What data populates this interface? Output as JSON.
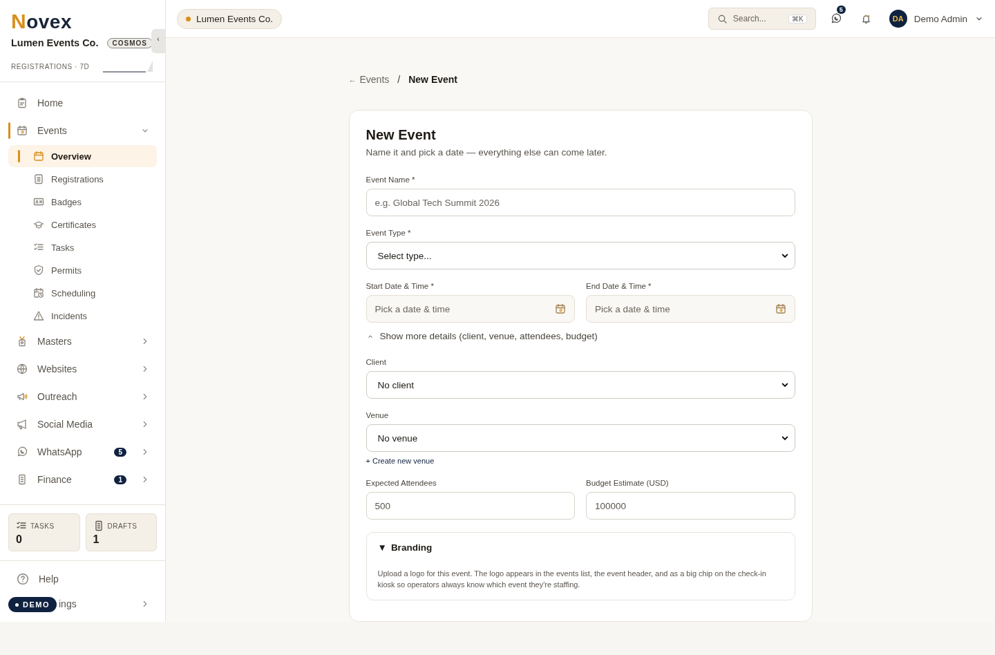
{
  "brand": {
    "logo_mark": "N",
    "logo_rest": "ovex"
  },
  "org": {
    "name": "Lumen Events Co.",
    "plan": "COSMOS"
  },
  "sparkline": {
    "label": "REGISTRATIONS · 7D"
  },
  "nav": [
    {
      "kind": "item",
      "label": "Home",
      "selected": false
    },
    {
      "kind": "group",
      "label": "Events",
      "selected": true,
      "expanded": true,
      "children": [
        {
          "label": "Overview",
          "selected": true
        },
        {
          "label": "Registrations",
          "selected": false
        },
        {
          "label": "Badges",
          "selected": false
        },
        {
          "label": "Certificates",
          "selected": false
        },
        {
          "label": "Tasks",
          "selected": false
        },
        {
          "label": "Permits",
          "selected": false
        },
        {
          "label": "Scheduling",
          "selected": false
        },
        {
          "label": "Incidents",
          "selected": false
        }
      ]
    },
    {
      "kind": "group",
      "label": "Masters",
      "selected": false,
      "expanded": false
    },
    {
      "kind": "group",
      "label": "Websites",
      "selected": false,
      "expanded": false
    },
    {
      "kind": "group",
      "label": "Outreach",
      "selected": false,
      "expanded": false
    },
    {
      "kind": "group",
      "label": "Social Media",
      "selected": false,
      "expanded": false
    },
    {
      "kind": "group",
      "label": "WhatsApp",
      "selected": false,
      "expanded": false,
      "badge": "5"
    },
    {
      "kind": "group",
      "label": "Finance",
      "selected": false,
      "expanded": false,
      "badge": "1"
    }
  ],
  "collapse_tab": "‹",
  "stats": [
    {
      "label": "TASKS",
      "value": "0"
    },
    {
      "label": "DRAFTS",
      "value": "1"
    }
  ],
  "footer_nav": [
    {
      "kind": "item",
      "label": "Help"
    },
    {
      "kind": "group",
      "label": "ings",
      "expanded": false
    }
  ],
  "demo_badge": "DEMO",
  "topbar": {
    "workspace": "Lumen Events Co.",
    "search_placeholder": "Search...",
    "shortcut": "⌘K",
    "chat_count": "5",
    "user_initials": "DA",
    "user_name": "Demo Admin"
  },
  "breadcrumb": {
    "back_arrow": "←",
    "items": [
      {
        "label": "Events",
        "kind": "link"
      },
      {
        "label": "New Event",
        "kind": "current"
      }
    ],
    "separator": "/"
  },
  "form": {
    "title": "New Event",
    "subtitle": "Name it and pick a date — everything else can come later.",
    "rows": [
      {
        "fields": [
          {
            "kind": "text",
            "label": "Event Name *",
            "placeholder": "e.g. Global Tech Summit 2026"
          }
        ]
      },
      {
        "fields": [
          {
            "kind": "select",
            "label": "Event Type *",
            "value": "Select type..."
          }
        ]
      },
      {
        "fields": [
          {
            "kind": "date",
            "label": "Start Date & Time *",
            "placeholder": "Pick a date & time"
          },
          {
            "kind": "date",
            "label": "End Date & Time *",
            "placeholder": "Pick a date & time"
          }
        ]
      },
      {
        "toggle": {
          "label": "Show more details (client, venue, attendees, budget)",
          "expanded": true
        }
      },
      {
        "fields": [
          {
            "kind": "select",
            "label": "Client",
            "value": "No client"
          }
        ]
      },
      {
        "fields": [
          {
            "kind": "select",
            "label": "Venue",
            "value": "No venue",
            "link": "+ Create new venue"
          }
        ]
      },
      {
        "fields": [
          {
            "kind": "text",
            "label": "Expected Attendees",
            "value": "500"
          },
          {
            "kind": "text",
            "label": "Budget Estimate (USD)",
            "value": "100000"
          }
        ]
      }
    ],
    "branding": {
      "title": "Branding",
      "marker": "▼",
      "expanded": true,
      "text": "Upload a logo for this event. The logo appears in the events list, the event header, and as a big chip on the check-in kiosk so operators always know which event they're staffing."
    }
  }
}
